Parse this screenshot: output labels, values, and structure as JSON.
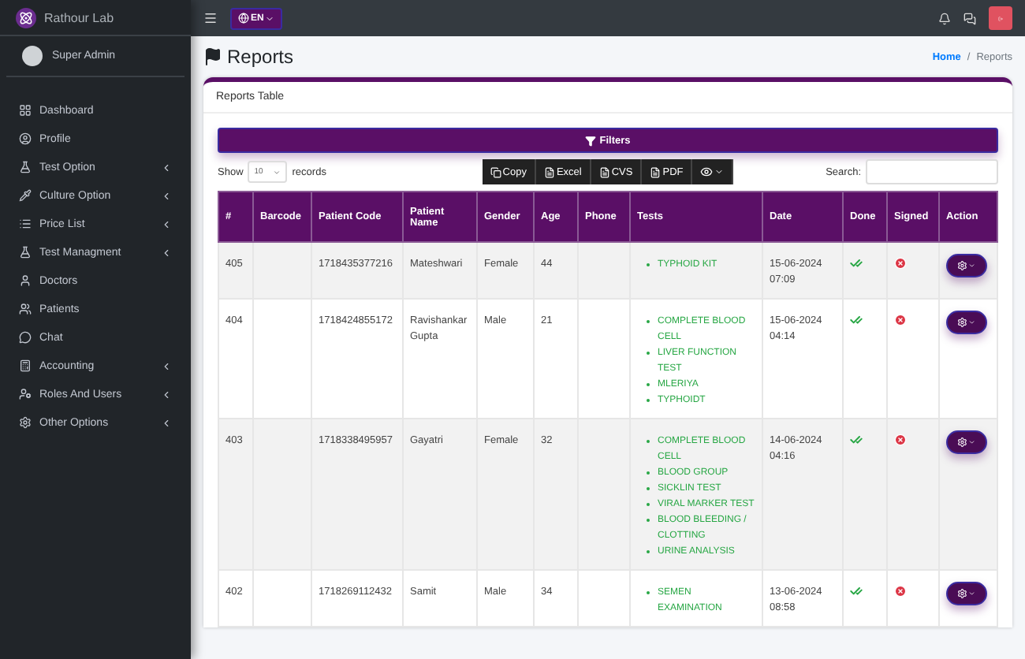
{
  "brand": {
    "name": "Rathour Lab"
  },
  "user": {
    "name": "Super Admin"
  },
  "sidebar": {
    "items": [
      {
        "label": "Dashboard",
        "has_submenu": false
      },
      {
        "label": "Profile",
        "has_submenu": false
      },
      {
        "label": "Test Option",
        "has_submenu": true
      },
      {
        "label": "Culture Option",
        "has_submenu": true
      },
      {
        "label": "Price List",
        "has_submenu": true
      },
      {
        "label": "Test Managment",
        "has_submenu": true
      },
      {
        "label": "Doctors",
        "has_submenu": false
      },
      {
        "label": "Patients",
        "has_submenu": false
      },
      {
        "label": "Chat",
        "has_submenu": false
      },
      {
        "label": "Accounting",
        "has_submenu": true
      },
      {
        "label": "Roles And Users",
        "has_submenu": true
      },
      {
        "label": "Other Options",
        "has_submenu": true
      }
    ]
  },
  "topbar": {
    "language": "EN"
  },
  "page": {
    "title": "Reports",
    "breadcrumb_separator": "/",
    "breadcrumb": [
      {
        "label": "Home",
        "link": true
      },
      {
        "label": "Reports",
        "link": false
      }
    ]
  },
  "card": {
    "title": "Reports Table",
    "filters_label": "Filters",
    "length": {
      "before": "Show",
      "value": "10",
      "after": "records"
    },
    "export_buttons": [
      "Copy",
      "Excel",
      "CVS",
      "PDF"
    ],
    "search_label": "Search:"
  },
  "table": {
    "columns": [
      "#",
      "Barcode",
      "Patient Code",
      "Patient Name",
      "Gender",
      "Age",
      "Phone",
      "Tests",
      "Date",
      "Done",
      "Signed",
      "Action"
    ],
    "rows": [
      {
        "id": "405",
        "barcode": "",
        "code": "1718435377216",
        "name": "Mateshwari",
        "gender": "Female",
        "age": "44",
        "phone": "",
        "tests": [
          "TYPHOID KIT"
        ],
        "date": "15-06-2024",
        "time": "07:09",
        "done": true,
        "signed": false
      },
      {
        "id": "404",
        "barcode": "",
        "code": "1718424855172",
        "name": "Ravishankar Gupta",
        "gender": "Male",
        "age": "21",
        "phone": "",
        "tests": [
          "COMPLETE BLOOD CELL",
          "LIVER FUNCTION TEST",
          "MLERIYA",
          "TYPHOIDT"
        ],
        "date": "15-06-2024",
        "time": "04:14",
        "done": true,
        "signed": false
      },
      {
        "id": "403",
        "barcode": "",
        "code": "1718338495957",
        "name": "Gayatri",
        "gender": "Female",
        "age": "32",
        "phone": "",
        "tests": [
          "COMPLETE BLOOD CELL",
          "BLOOD GROUP",
          "SICKLIN TEST",
          "VIRAL MARKER TEST",
          "BLOOD BLEEDING / CLOTTING",
          "URINE ANALYSIS"
        ],
        "date": "14-06-2024",
        "time": "04:16",
        "done": true,
        "signed": false
      },
      {
        "id": "402",
        "barcode": "",
        "code": "1718269112432",
        "name": "Samit",
        "gender": "Male",
        "age": "34",
        "phone": "",
        "tests": [
          "SEMEN EXAMINATION"
        ],
        "date": "13-06-2024",
        "time": "08:58",
        "done": true,
        "signed": false
      }
    ]
  }
}
